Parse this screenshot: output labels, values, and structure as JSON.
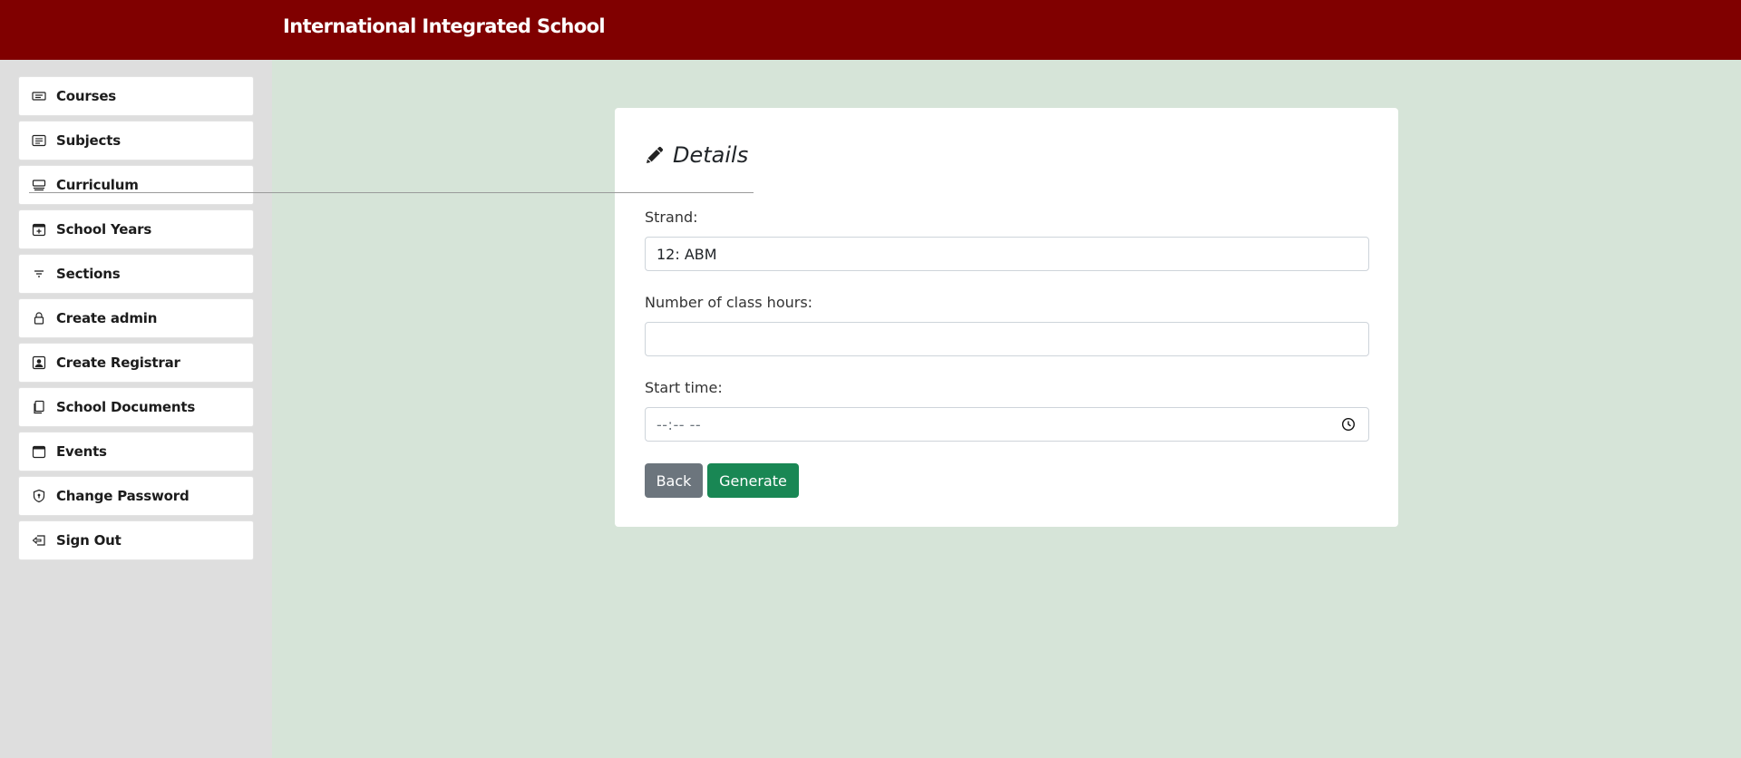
{
  "header": {
    "title": "International Integrated School",
    "color": "#800000"
  },
  "sidebar": {
    "items": [
      {
        "label": "Courses",
        "icon": "ticket-icon"
      },
      {
        "label": "Subjects",
        "icon": "list-card-icon"
      },
      {
        "label": "Curriculum",
        "icon": "stack-icon"
      },
      {
        "label": "School Years",
        "icon": "calendar-plus-icon"
      },
      {
        "label": "Sections",
        "icon": "filter-icon"
      },
      {
        "label": "Create admin",
        "icon": "lock-icon"
      },
      {
        "label": "Create Registrar",
        "icon": "person-badge-icon"
      },
      {
        "label": "School Documents",
        "icon": "documents-icon"
      },
      {
        "label": "Events",
        "icon": "calendar-icon"
      },
      {
        "label": "Change Password",
        "icon": "shield-icon"
      },
      {
        "label": "Sign Out",
        "icon": "sign-out-icon"
      }
    ]
  },
  "form": {
    "title": "Details",
    "strand_label": "Strand:",
    "strand_value": "12: ABM",
    "hours_label": "Number of class hours:",
    "hours_value": "",
    "start_label": "Start time:",
    "start_value": "--:-- --",
    "back_label": "Back",
    "generate_label": "Generate"
  },
  "colors": {
    "accent": "#800000",
    "background": "#d6e4d8",
    "sidebar": "#dedede",
    "back_button": "#6c757d",
    "generate_button": "#198754"
  }
}
